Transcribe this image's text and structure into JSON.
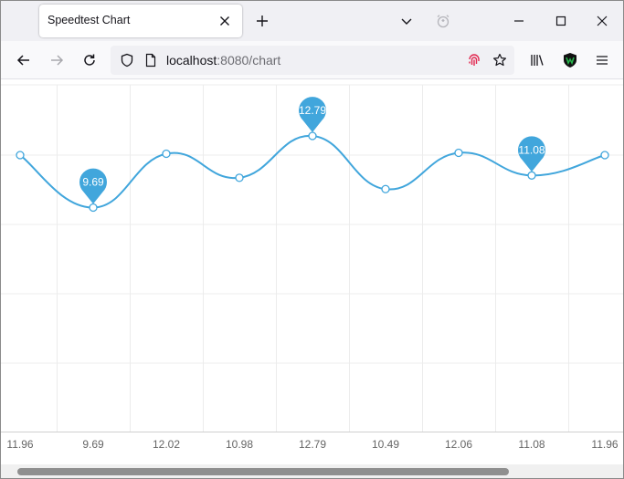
{
  "browser": {
    "tab_title": "Speedtest Chart",
    "url_host": "localhost",
    "url_rest": ":8080/chart"
  },
  "icons": {
    "tab_close": "close-icon",
    "new_tab": "plus-icon",
    "tab_list": "chevron-down-icon",
    "alarm": "alarm-clock-icon",
    "minimize": "minimize-icon",
    "maximize": "maximize-icon",
    "window_close": "close-icon",
    "back": "arrow-left-icon",
    "forward": "arrow-right-icon",
    "reload": "reload-icon",
    "shield": "shield-icon",
    "page": "page-icon",
    "fingerprint": "fingerprint-icon",
    "bookmark": "star-icon",
    "library": "library-icon",
    "extension": "shield-extension-icon",
    "menu": "hamburger-menu-icon"
  },
  "colors": {
    "series": "#41a6dc",
    "grid": "#ececec",
    "axis_text": "#666666",
    "fingerprint": "#e22850",
    "extension": "#26b34a"
  },
  "chart_data": {
    "type": "line",
    "smooth": true,
    "categories": [
      "11.96",
      "9.69",
      "12.02",
      "10.98",
      "12.79",
      "10.49",
      "12.06",
      "11.08",
      "11.96"
    ],
    "values": [
      11.96,
      9.69,
      12.02,
      10.98,
      12.79,
      10.49,
      12.06,
      11.08,
      11.96
    ],
    "ylim": [
      0,
      15
    ],
    "grid": true,
    "markers": [
      {
        "index": 1,
        "label": "9.69"
      },
      {
        "index": 4,
        "label": "12.79"
      },
      {
        "index": 7,
        "label": "11.08"
      }
    ]
  }
}
